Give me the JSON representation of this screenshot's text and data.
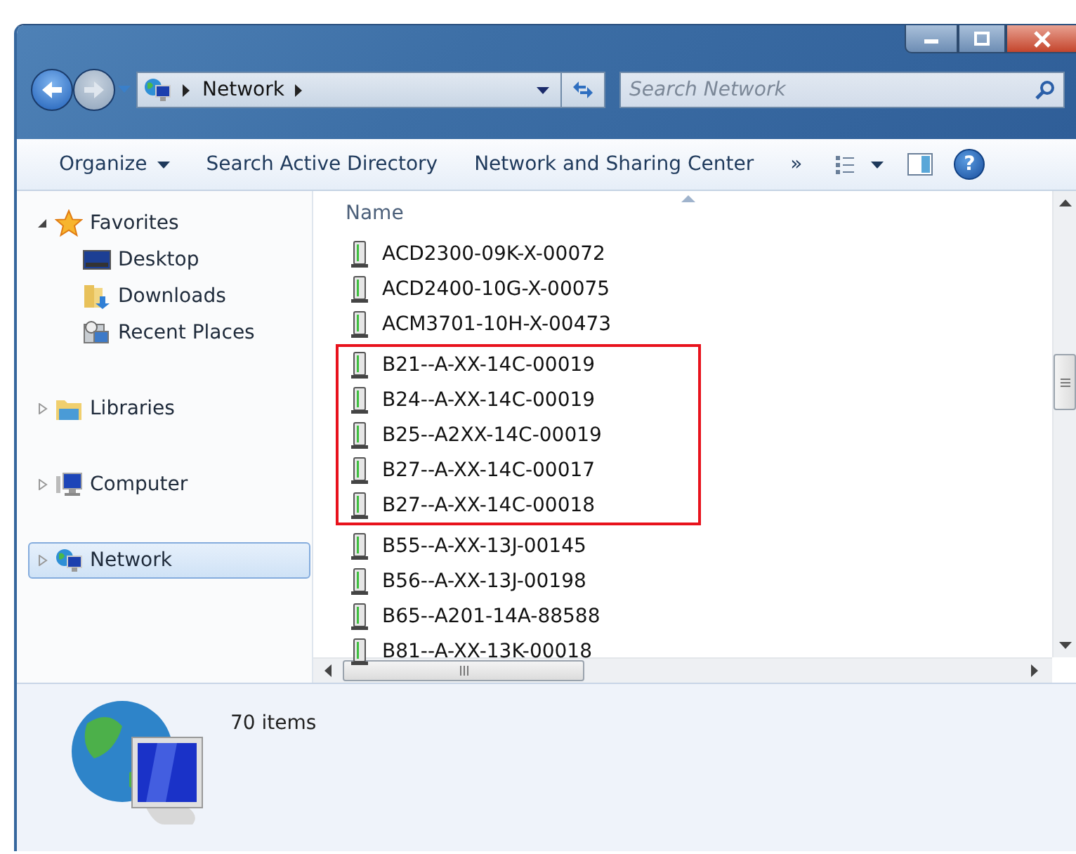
{
  "address_bar": {
    "segments": [
      "Network"
    ]
  },
  "search": {
    "placeholder": "Search Network"
  },
  "toolbar": {
    "items": [
      {
        "label": "Organize",
        "kind": "menu"
      },
      {
        "label": "Search Active Directory",
        "kind": "plain"
      },
      {
        "label": "Network and Sharing Center",
        "kind": "plain"
      },
      {
        "label": "»",
        "kind": "plain"
      }
    ]
  },
  "help_button": {
    "label": "?"
  },
  "navigation": [
    {
      "label": "Favorites",
      "expanded": true,
      "selected": false,
      "children": [
        {
          "label": "Desktop",
          "selected": false
        },
        {
          "label": "Downloads",
          "selected": false
        },
        {
          "label": "Recent Places",
          "selected": false
        }
      ]
    },
    {
      "label": "Libraries",
      "expanded": false,
      "selected": false
    },
    {
      "label": "Computer",
      "expanded": false,
      "selected": false
    },
    {
      "label": "Network",
      "expanded": false,
      "selected": true
    }
  ],
  "file_list": {
    "column": "Name",
    "groups": [
      {
        "files": [
          "ACD2300-09K-X-00072",
          "ACD2400-10G-X-00075",
          "ACM3701-10H-X-00473"
        ]
      },
      {
        "highlighted": true,
        "files": [
          "B21--A-XX-14C-00019",
          "B24--A-XX-14C-00019",
          "B25--A2XX-14C-00019",
          "B27--A-XX-14C-00017",
          "B27--A-XX-14C-00018"
        ]
      },
      {
        "files": [
          "B55--A-XX-13J-00145",
          "B56--A-XX-13J-00198",
          "B65--A201-14A-88588",
          "B81--A-XX-13K-00018"
        ]
      }
    ]
  },
  "status": {
    "count": "70 items"
  }
}
